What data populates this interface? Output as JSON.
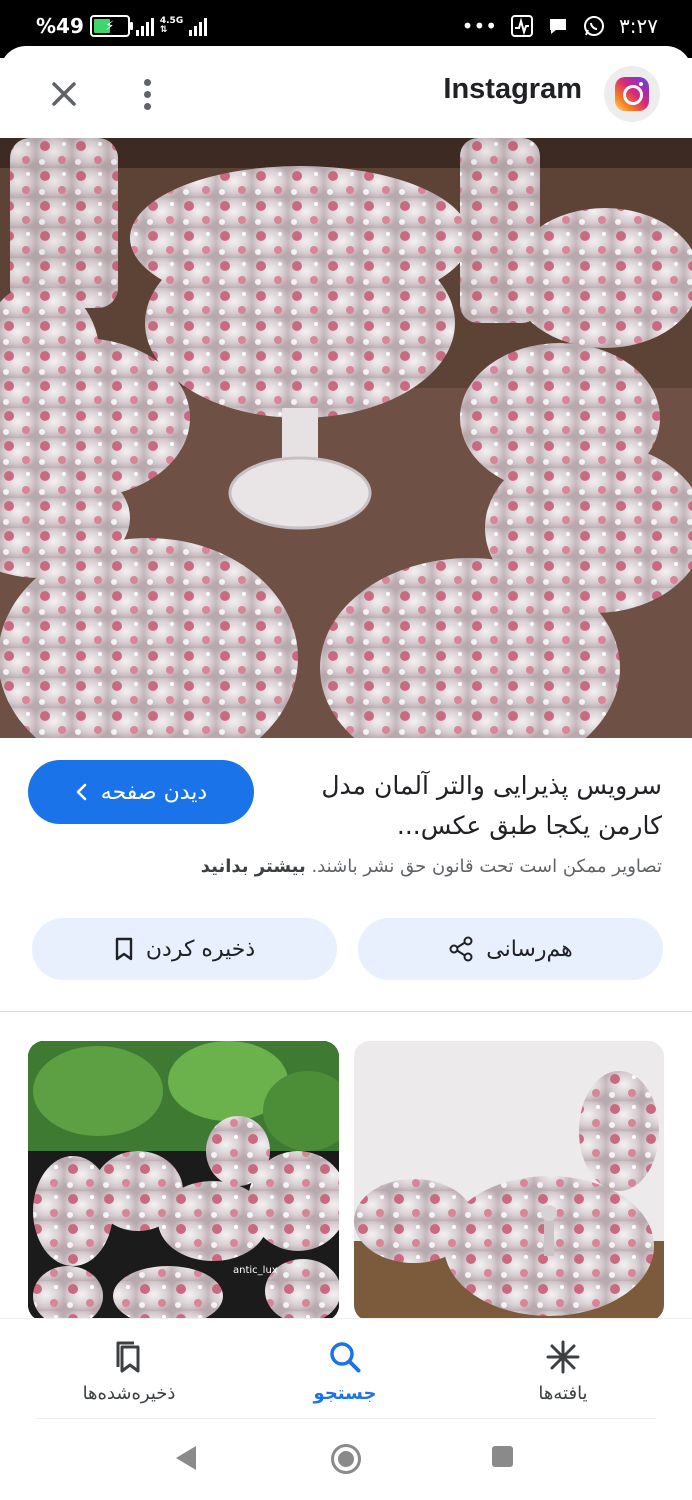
{
  "status_bar": {
    "battery": "%49",
    "network": "4.5G",
    "time": "۳:۲۷",
    "dots": "•••"
  },
  "header": {
    "source_name": "Instagram",
    "close_icon": "close-icon",
    "more_icon": "more-vert-icon"
  },
  "result": {
    "title": "سرویس پذیرایی والتر آلمان مدل کارمن یکجا طبق عکس...",
    "visit_button": "دیدن صفحه",
    "copyright_text": "تصاویر ممکن است تحت قانون حق نشر باشند.",
    "learn_more": "بیشتر بدانید",
    "share_button": "هم‌رسانی",
    "save_button": "ذخیره کردن"
  },
  "thumbnails": [
    {
      "watermark": "antic_lux"
    },
    {
      "watermark": ""
    }
  ],
  "bottom_nav": {
    "items": [
      {
        "label": "یافته‌ها",
        "icon": "asterisk-icon"
      },
      {
        "label": "جستجو",
        "icon": "search-icon"
      },
      {
        "label": "ذخیره‌شده‌ها",
        "icon": "bookmarks-icon"
      }
    ]
  },
  "colors": {
    "accent": "#1a73e8",
    "pill_bg": "#e8f0fe",
    "text": "#202124",
    "muted": "#5f6368"
  }
}
